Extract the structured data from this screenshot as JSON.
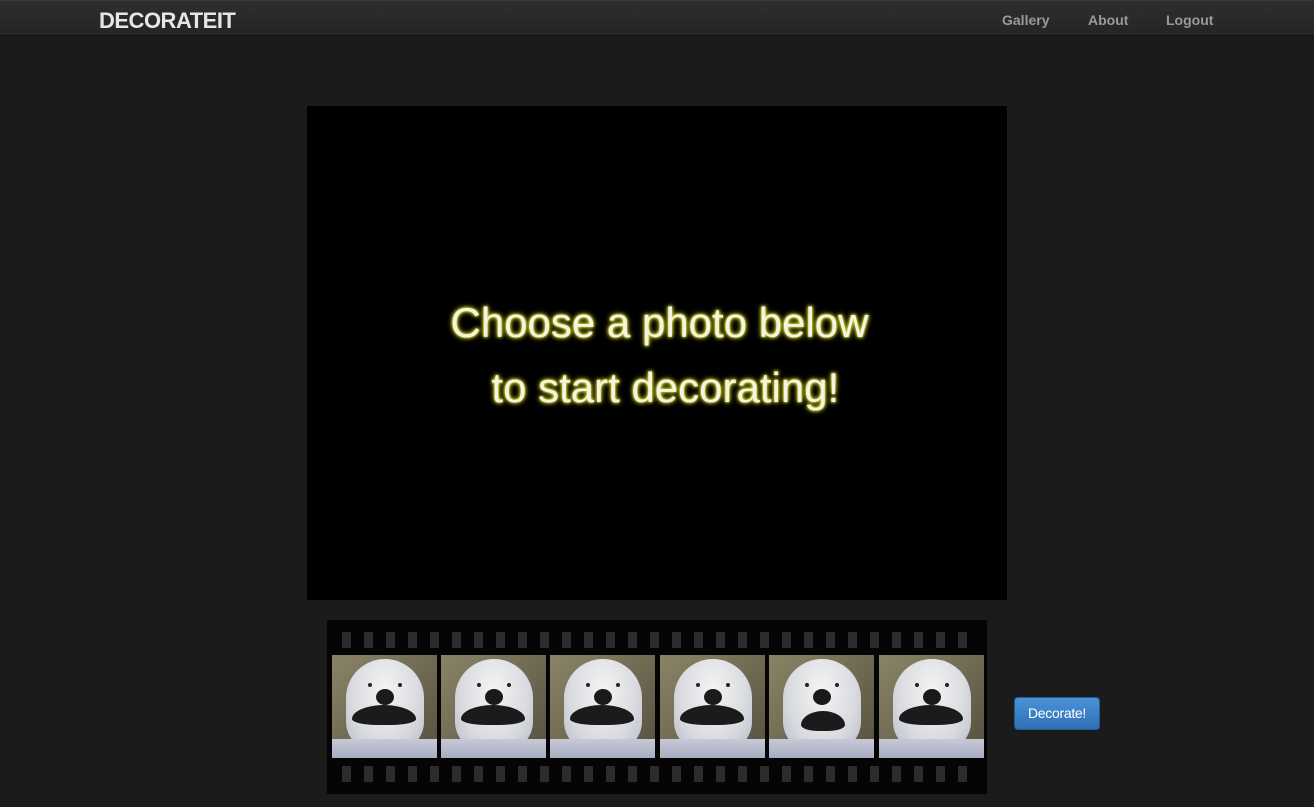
{
  "navbar": {
    "brand": "DECORATEIT",
    "links": [
      {
        "label": "Gallery"
      },
      {
        "label": "About"
      },
      {
        "label": "Logout"
      }
    ]
  },
  "canvas": {
    "prompt_line1": "Choose a photo below",
    "prompt_line2": " to start decorating!"
  },
  "filmstrip": {
    "frame_count": 6
  },
  "actions": {
    "decorate_label": "Decorate!"
  },
  "colors": {
    "background": "#1b1b1b",
    "canvas": "#000000",
    "prompt_glow": "#e8e840",
    "button": "#3a80c8"
  }
}
